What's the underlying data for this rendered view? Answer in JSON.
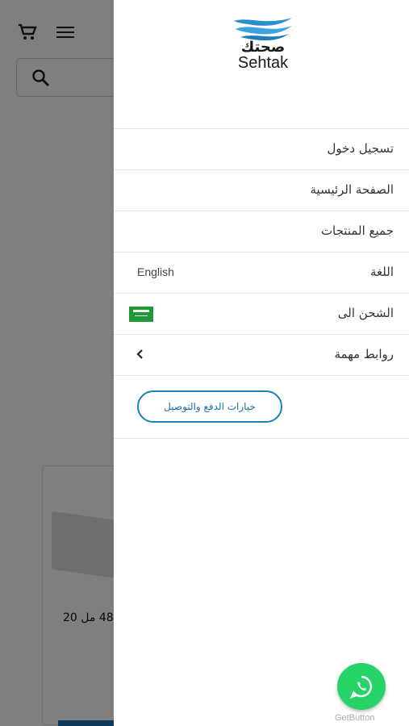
{
  "background": {
    "product_name": "48 مل 20"
  },
  "drawer": {
    "logo": {
      "arabic": "صحتك",
      "english": "Sehtak"
    },
    "menu": [
      {
        "label": "تسجيل دخول"
      },
      {
        "label": "الصفحة الرئيسية"
      },
      {
        "label": "جميع المنتجات"
      },
      {
        "label": "اللغة",
        "value": "English"
      },
      {
        "label": "الشحن الى"
      },
      {
        "label": "روابط مهمة"
      }
    ],
    "payment_button": "خيارات الدفع والتوصيل"
  },
  "widget": {
    "label": "GetButton"
  },
  "colors": {
    "accent": "#1f7fb8",
    "whatsapp": "#25d366",
    "flag": "#1f9a3a"
  }
}
